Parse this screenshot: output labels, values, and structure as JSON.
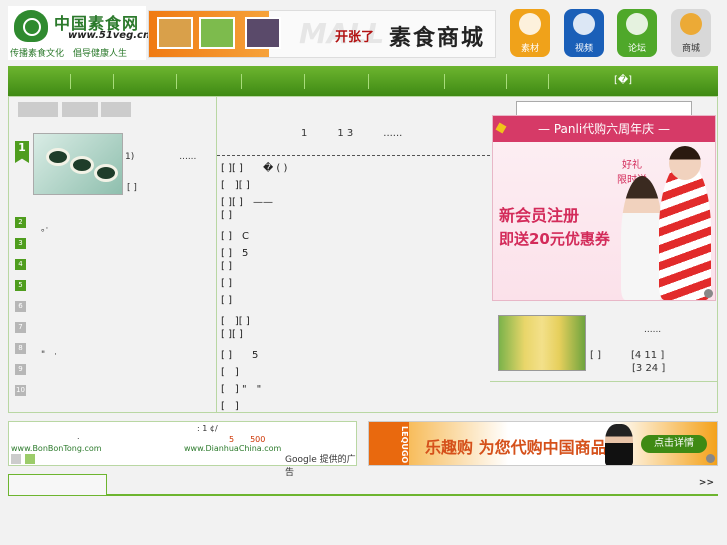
{
  "header": {
    "logo_title": "中国素食网",
    "logo_url": "www.51veg.cn",
    "logo_slogan": "传播素食文化　倡导健康人生",
    "banner_mall": "MALL",
    "banner_open": "开张了",
    "banner_store": "素食商城",
    "icons": [
      {
        "label": "素材",
        "icon": "folder-icon",
        "color": "#f0a21a"
      },
      {
        "label": "视频",
        "icon": "video-icon",
        "color": "#1a5fb8"
      },
      {
        "label": "论坛",
        "icon": "forum-icon",
        "color": "#4fa82a"
      },
      {
        "label": "商城",
        "icon": "shop-icon",
        "color": "#e0e0e0"
      }
    ]
  },
  "nav": {
    "right_text": "[�]"
  },
  "left": {
    "rank1": "1",
    "feat_text1": "1)　　　　　......",
    "feat_text2": "[ ]",
    "ranks": [
      {
        "n": "2",
        "text": "。·",
        "color": "#4f9d1e"
      },
      {
        "n": "3",
        "text": "",
        "color": "#4f9d1e"
      },
      {
        "n": "4",
        "text": "",
        "color": "#4f9d1e"
      },
      {
        "n": "5",
        "text": "",
        "color": "#4f9d1e"
      },
      {
        "n": "6",
        "text": "",
        "color": "#b7b7b7"
      },
      {
        "n": "7",
        "text": "",
        "color": "#b7b7b7"
      },
      {
        "n": "8",
        "text": "\"　·",
        "color": "#b7b7b7"
      },
      {
        "n": "9",
        "text": "",
        "color": "#b7b7b7"
      },
      {
        "n": "10",
        "text": "",
        "color": "#b7b7b7"
      }
    ]
  },
  "mid": {
    "head": "1　　　1 3　　　......",
    "rows": [
      "[ ][ ]　　� ( )",
      "[　][ ]",
      "[ ][ ]　——",
      "[ ]",
      "[ ]　C",
      "[ ]　5",
      "[ ]",
      "[ ]",
      "[ ]",
      "[　][ ]",
      "[ ][ ]",
      "[ ]　　5",
      "[　]",
      "[　] \"　\"",
      "[　]"
    ]
  },
  "right": {
    "ad_top": "— Panli代购六周年庆 —",
    "ad_gift1": "好礼",
    "ad_gift2": "限时送",
    "ad_line1": "新会员注册",
    "ad_line2": "即送20元优惠券",
    "corn_text1": "......",
    "corn_text2": "[ ]　　　[4 11 ]",
    "corn_text3": "[3 24 ]"
  },
  "bottom_ads": {
    "ad2_mid": ": 1 ¢/",
    "ad2_dot": ".",
    "ad2_price": "5　　500",
    "ad2_link1": "www.BonBonTong.com",
    "ad2_link2": "www.DianhuaChina.com",
    "ad2_google": "Google 提供的广告",
    "ad3_logo": "LEQUGO",
    "ad3_title": "乐趣购 为您代购中国商品",
    "ad3_btn": "点击详情"
  },
  "bottom_bar": {
    "more": ">>"
  }
}
